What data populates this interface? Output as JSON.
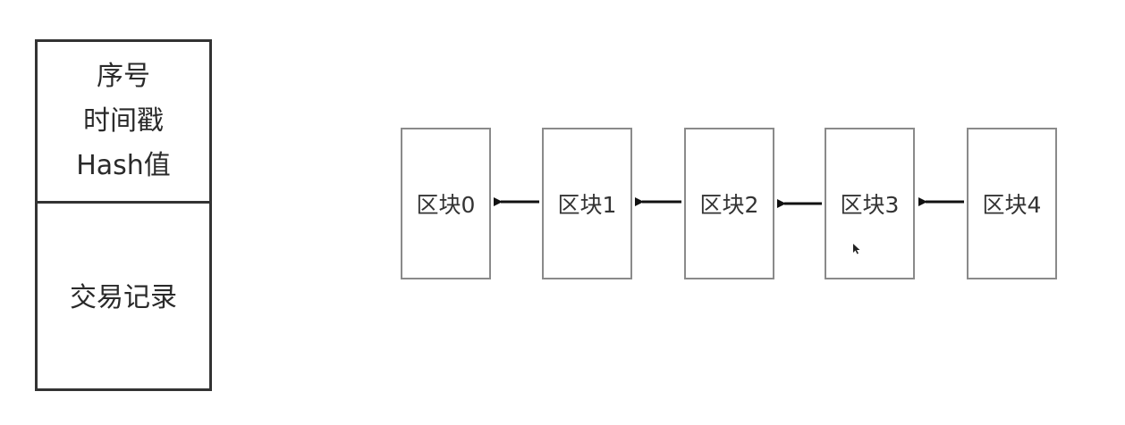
{
  "block_detail": {
    "header_lines": [
      "序号",
      "时间戳",
      "Hash值"
    ],
    "body_label": "交易记录"
  },
  "chain": {
    "blocks": [
      "区块0",
      "区块1",
      "区块2",
      "区块3",
      "区块4"
    ],
    "arrow_direction": "right-to-left"
  },
  "colors": {
    "detail_border": "#333333",
    "block_border": "#8a8a8a",
    "arrow": "#111111"
  }
}
